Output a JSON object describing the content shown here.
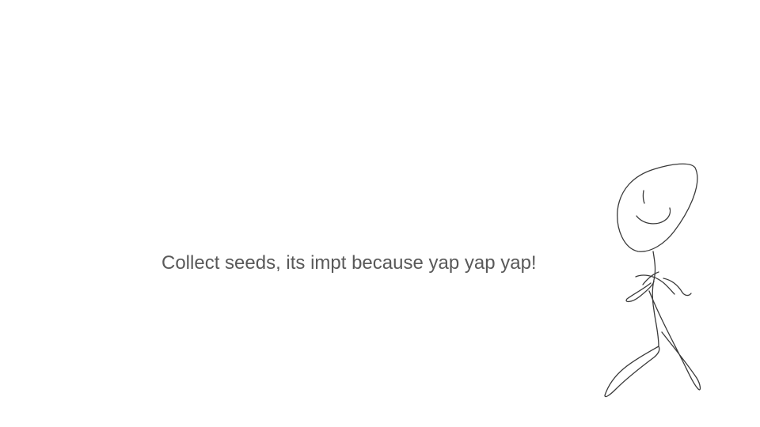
{
  "slide": {
    "caption": "Collect seeds, its impt because yap yap yap!",
    "text_color": "#595959",
    "background": "#ffffff",
    "stroke_color": "#3a3a3a"
  },
  "illustration": {
    "subject": "stick-figure-icon"
  }
}
